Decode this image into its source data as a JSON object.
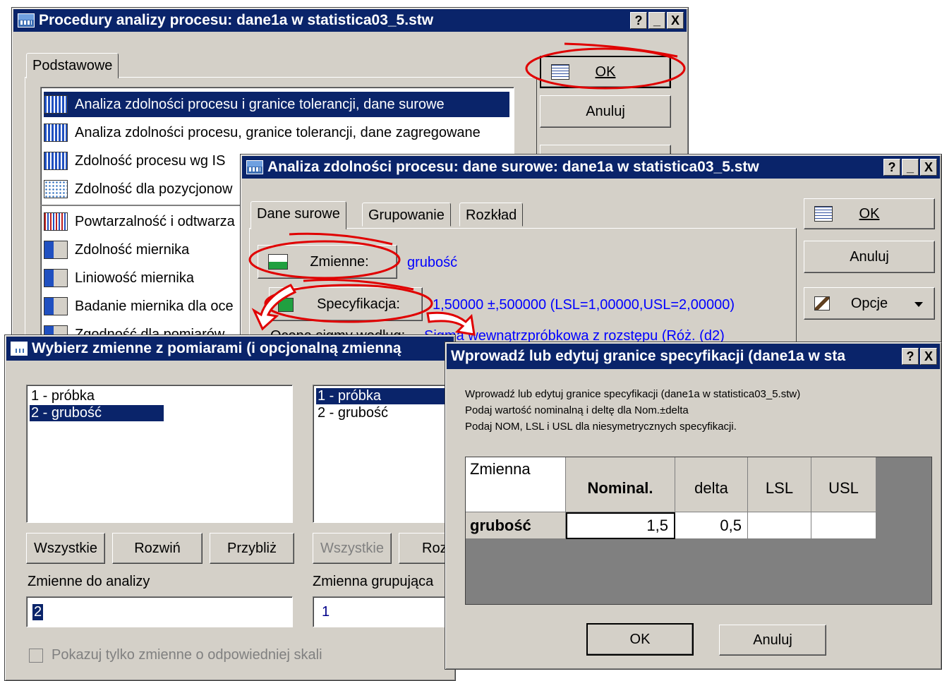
{
  "procedures": {
    "title": "Procedury analizy procesu: dane1a w statistica03_5.stw",
    "tab": "Podstawowe",
    "ok": "OK",
    "cancel": "Anuluj",
    "items": [
      {
        "label": "Analiza zdolności procesu i granice tolerancji, dane surowe",
        "icon": "histogram-icon",
        "selected": true
      },
      {
        "label": "Analiza zdolności procesu, granice tolerancji, dane zagregowane",
        "icon": "histogram-icon"
      },
      {
        "label": "Zdolność procesu wg IS",
        "icon": "histogram-icon"
      },
      {
        "label": "Zdolność dla pozycjonow",
        "icon": "scatter-icon"
      },
      {
        "label": "Powtarzalność i odtwarza",
        "icon": "bars-icon"
      },
      {
        "label": "Zdolność miernika",
        "icon": "gauge-icon"
      },
      {
        "label": "Liniowość miernika",
        "icon": "gauge-icon"
      },
      {
        "label": "Badanie miernika dla oce",
        "icon": "gauge-icon"
      },
      {
        "label": "Zgodność dla pomiarów",
        "icon": "gauge-icon"
      }
    ]
  },
  "raw_analysis": {
    "title": "Analiza zdolności procesu: dane surowe: dane1a w statistica03_5.stw",
    "tabs": [
      "Dane surowe",
      "Grupowanie",
      "Rozkład"
    ],
    "variables_button": "Zmienne:",
    "variables_value": "grubość",
    "spec_button": "Specyfikacja:",
    "spec_value": "1,50000 ±,500000  (LSL=1,00000,USL=2,00000)",
    "sigma_label": "Ocena sigmy według:",
    "sigma_value": "Sigma wewnątrzpróbkowa z rozstępu (Róż. (d2)",
    "ok": "OK",
    "cancel": "Anuluj",
    "options": "Opcje"
  },
  "select_vars": {
    "title": "Wybierz zmienne z pomiarami (i opcjonalną zmienną",
    "left_list": [
      "1 - próbka",
      "2 - grubość"
    ],
    "right_list": [
      "1 - próbka",
      "2 - grubość"
    ],
    "btn_all": "Wszystkie",
    "btn_expand": "Rozwiń",
    "btn_zoom": "Przybliż",
    "btn_all2": "Wszystkie",
    "btn_expand2": "Roz",
    "analysis_label": "Zmienne do analizy",
    "analysis_value": "2",
    "group_label": "Zmienna grupująca",
    "group_value": "1",
    "checkbox_label": "Pokazuj tylko zmienne o odpowiedniej skali"
  },
  "spec_limits": {
    "title": "Wprowadź lub edytuj granice specyfikacji (dane1a w sta",
    "info1": "Wprowadź lub edytuj granice specyfikacji (dane1a w statistica03_5.stw)",
    "info2": "Podaj wartość nominalną i deltę dla Nom.±delta",
    "info3": "Podaj NOM, LSL i USL dla niesymetrycznych specyfikacji.",
    "headers": [
      "Zmienna",
      "Nominal.",
      "delta",
      "LSL",
      "USL"
    ],
    "row": {
      "name": "grubość",
      "nominal": "1,5",
      "delta": "0,5",
      "lsl": "",
      "usl": ""
    },
    "ok": "OK",
    "cancel": "Anuluj"
  },
  "titlebar_buttons": {
    "help": "?",
    "minimize": "_",
    "close": "X"
  }
}
